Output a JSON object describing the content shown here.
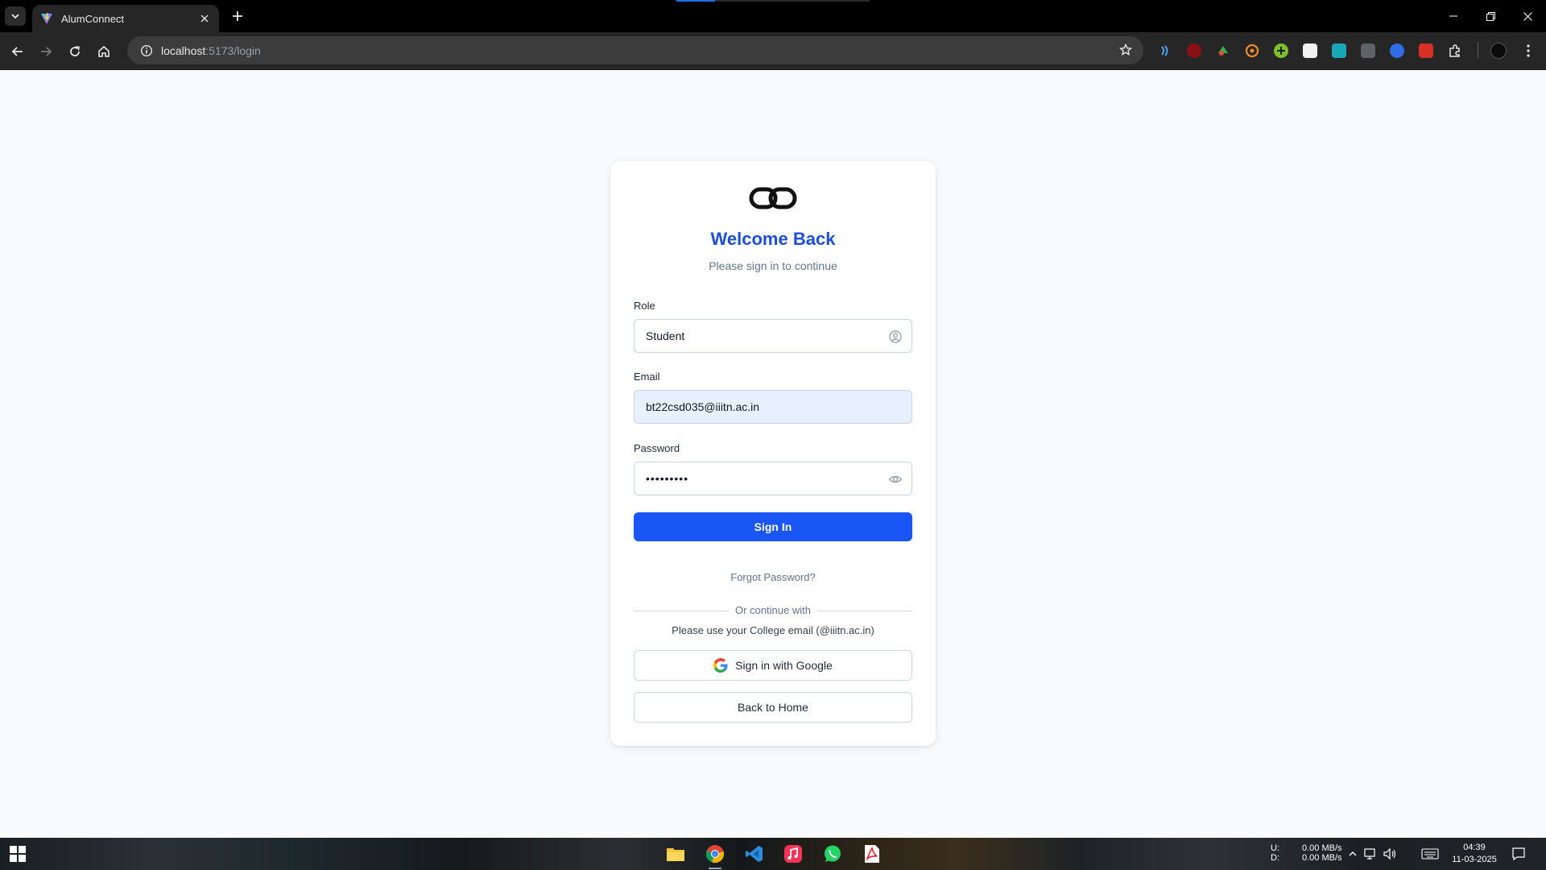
{
  "browser": {
    "tab_title": "AlumConnect",
    "url_host": "localhost",
    "url_path": ":5173/login"
  },
  "login": {
    "title": "Welcome Back",
    "subtitle": "Please sign in to continue",
    "role_label": "Role",
    "role_value": "Student",
    "email_label": "Email",
    "email_value": "bt22csd035@iiitn.ac.in",
    "password_label": "Password",
    "password_masked": "•••••••••",
    "sign_in_label": "Sign In",
    "forgot_password": "Forgot Password?",
    "divider_text": "Or continue with",
    "college_note": "Please use your College email (@iiitn.ac.in)",
    "google_button": "Sign in with Google",
    "back_home_button": "Back to Home",
    "colors": {
      "title": "#1d4ed8",
      "primary_button": "#1a56f5"
    }
  },
  "taskbar": {
    "net_upload_label": "U:",
    "net_download_label": "D:",
    "net_upload_value": "0.00 MB/s",
    "net_download_value": "0.00 MB/s",
    "time": "04:39",
    "date": "11-03-2025"
  }
}
